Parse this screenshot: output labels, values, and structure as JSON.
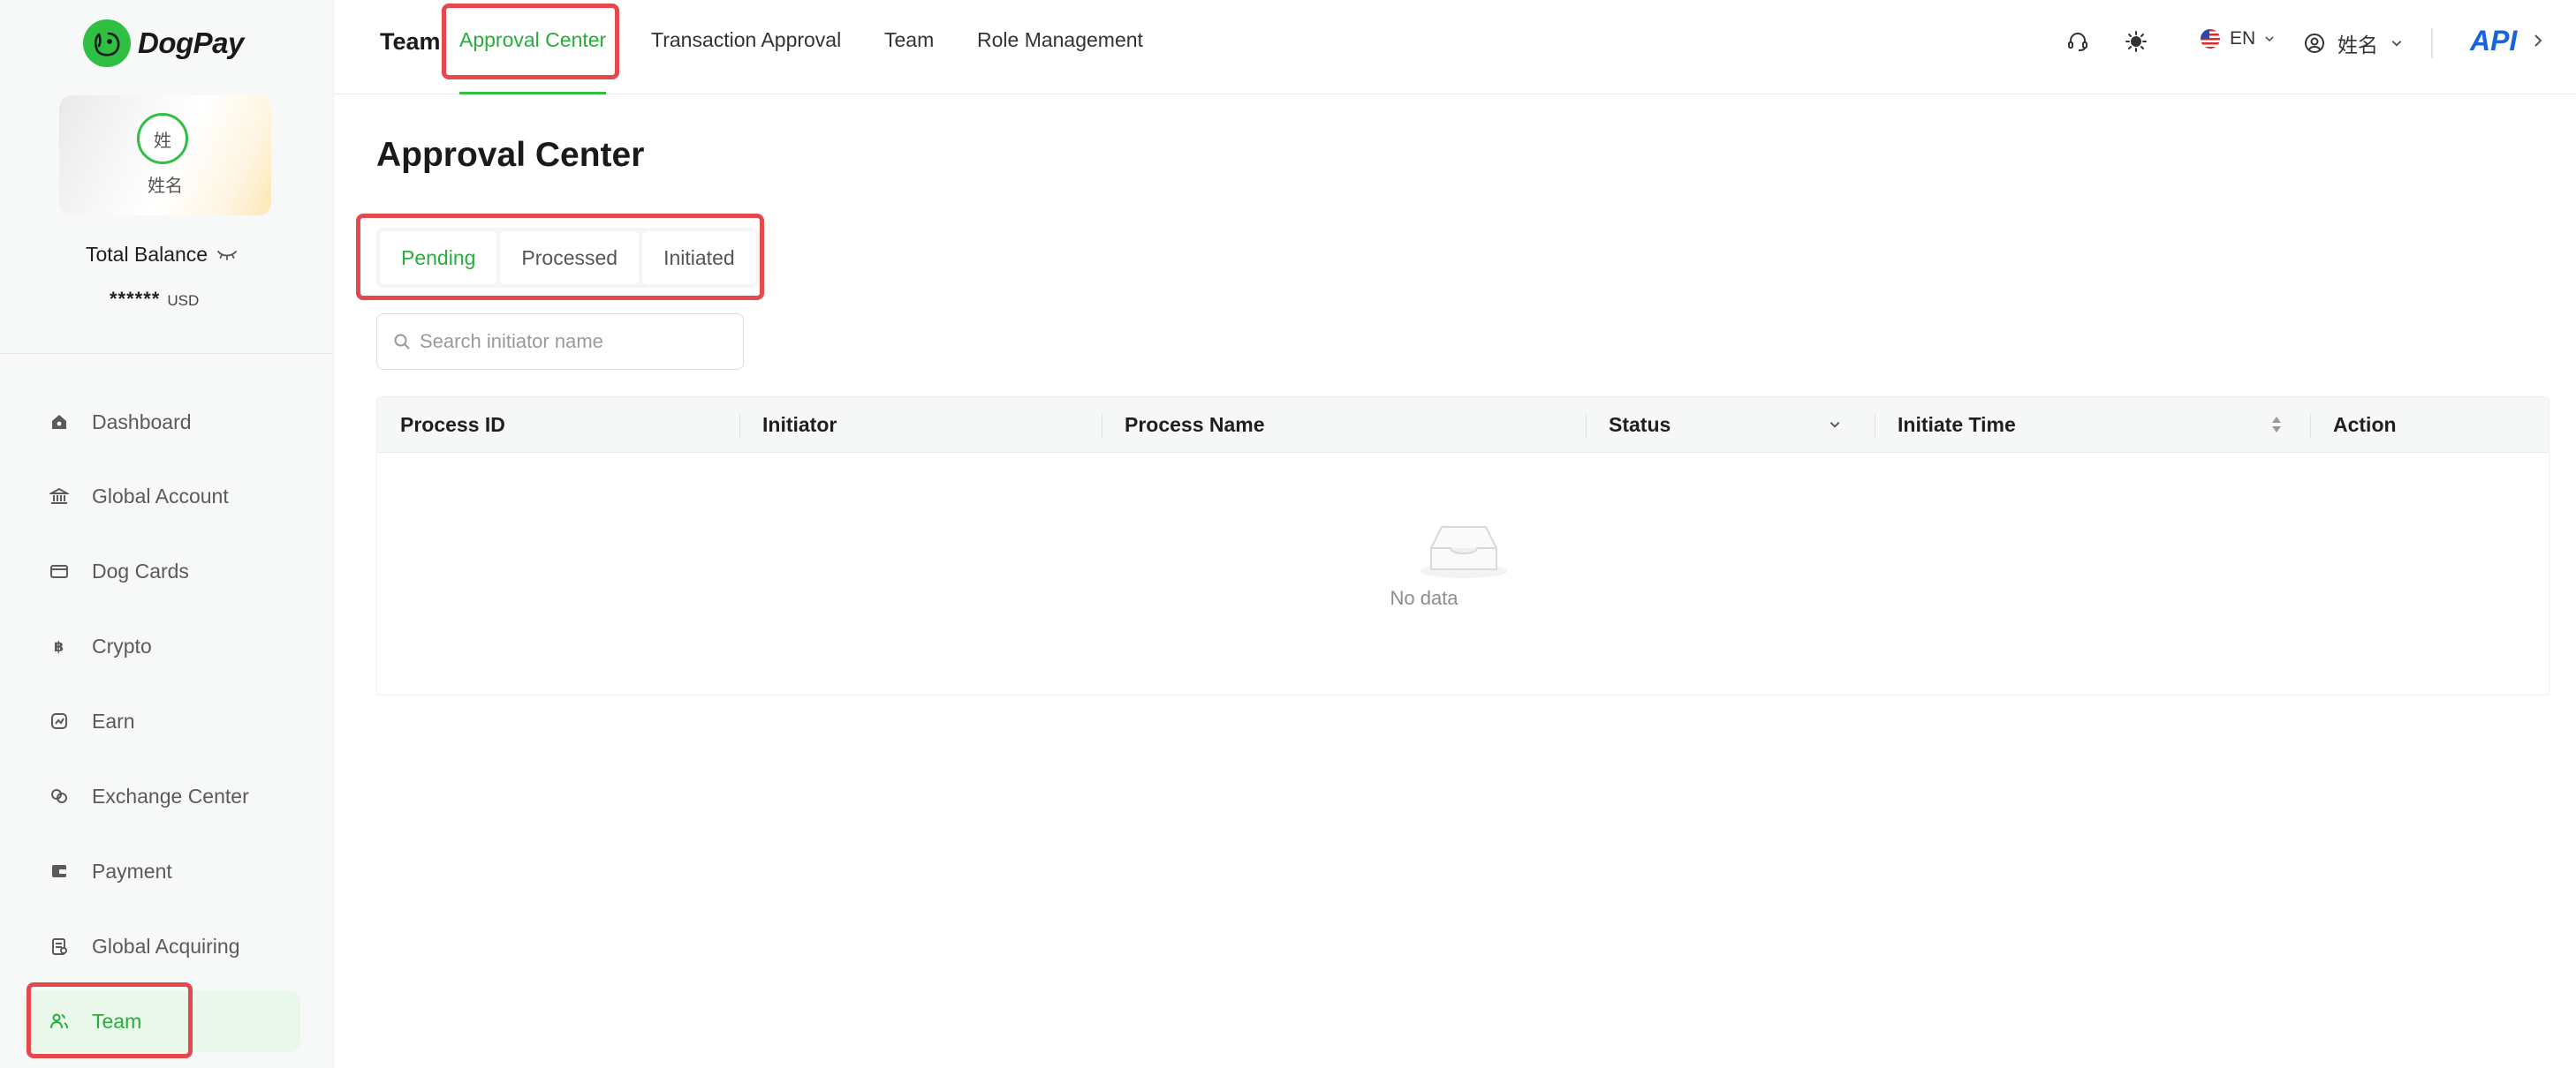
{
  "app": {
    "name": "DogPay",
    "brand_color": "#2fbf43",
    "accent_green": "#27ae3a",
    "highlight_color": "#e5484d",
    "api_color": "#1666d9"
  },
  "profile": {
    "avatar_char": "姓",
    "name": "姓名"
  },
  "balance": {
    "label": "Total Balance",
    "value": "******",
    "unit": "USD",
    "visibility_icon": "eye-closed-icon"
  },
  "sidebar": {
    "items": [
      {
        "label": "Dashboard",
        "icon": "dashboard-icon"
      },
      {
        "label": "Global Account",
        "icon": "bank-icon"
      },
      {
        "label": "Dog Cards",
        "icon": "card-icon"
      },
      {
        "label": "Crypto",
        "icon": "bitcoin-icon"
      },
      {
        "label": "Earn",
        "icon": "earn-icon"
      },
      {
        "label": "Exchange Center",
        "icon": "exchange-icon"
      },
      {
        "label": "Payment",
        "icon": "wallet-icon"
      },
      {
        "label": "Global Acquiring",
        "icon": "acquiring-icon"
      },
      {
        "label": "Team",
        "icon": "team-icon",
        "active": true
      }
    ]
  },
  "topbar": {
    "section_title": "Team",
    "nav": [
      "Approval Center",
      "Transaction Approval",
      "Team",
      "Role Management"
    ],
    "active_nav": "Approval Center",
    "language": "EN",
    "user_name": "姓名",
    "api_label": "API"
  },
  "main": {
    "title": "Approval Center",
    "tabs": [
      "Pending",
      "Processed",
      "Initiated"
    ],
    "active_tab": "Pending",
    "search": {
      "placeholder": "Search initiator name",
      "value": ""
    },
    "table": {
      "columns": [
        "Process ID",
        "Initiator",
        "Process Name",
        "Status",
        "Initiate Time",
        "Action"
      ],
      "rows": [],
      "empty_text": "No data"
    }
  }
}
